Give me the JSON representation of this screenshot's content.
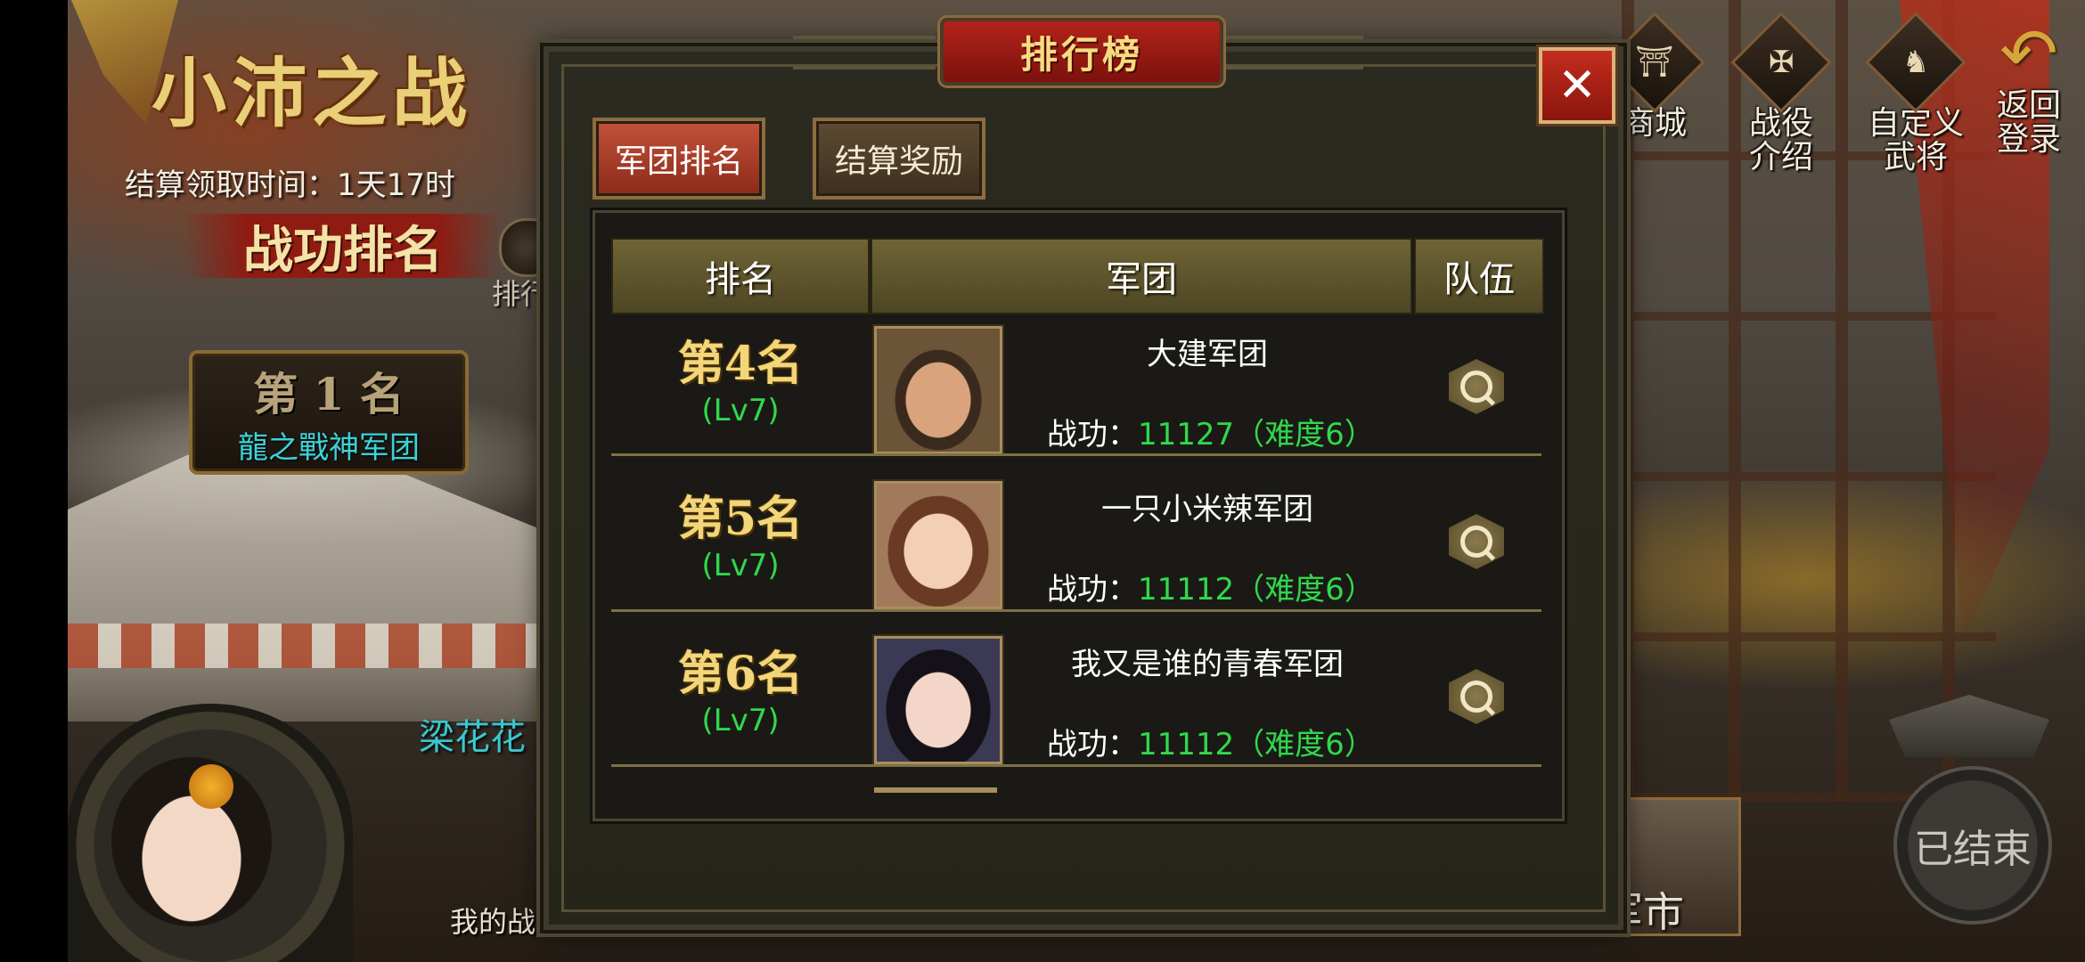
{
  "scene": {
    "battle_title": "小沛之战",
    "settle_time": "结算领取时间：1天17时",
    "merit_banner": "战功排名",
    "side_rank_label": "排行",
    "first_place": {
      "rank": "第 1 名",
      "name": "龍之戰神军团"
    },
    "player_name": "梁花花",
    "my_merit_label": "我的战功：",
    "market_label": "军市",
    "ended_label": "已结束"
  },
  "top_menu": [
    {
      "icon": "shop-icon",
      "glyph": "⛩",
      "label": "商城"
    },
    {
      "icon": "campaign-icon",
      "glyph": "✠",
      "label": "战役\n介绍"
    },
    {
      "icon": "custom-general-icon",
      "glyph": "♞",
      "label": "自定义\n武将"
    },
    {
      "icon": "back-arrow-icon",
      "glyph": "↶",
      "label": "返回\n登录"
    }
  ],
  "modal": {
    "title": "排行榜",
    "close_glyph": "✕",
    "tabs": [
      {
        "label": "军团排名",
        "active": true
      },
      {
        "label": "结算奖励",
        "active": false
      }
    ],
    "columns": [
      "排名",
      "军团",
      "队伍"
    ],
    "rows": [
      {
        "rank": "第4名",
        "level": "(Lv7)",
        "team": "大建军团",
        "merit_label": "战功：",
        "merit_value": "11127（难度6）"
      },
      {
        "rank": "第5名",
        "level": "(Lv7)",
        "team": "一只小米辣军团",
        "merit_label": "战功：",
        "merit_value": "11112（难度6）"
      },
      {
        "rank": "第6名",
        "level": "(Lv7)",
        "team": "我又是谁的青春军团",
        "merit_label": "战功：",
        "merit_value": "11112（难度6）"
      }
    ]
  },
  "colors": {
    "accent_red": "#b2231a",
    "gold_text": "#f3d57a",
    "green_value": "#31d84a",
    "cyan_name": "#3ad3d9"
  }
}
